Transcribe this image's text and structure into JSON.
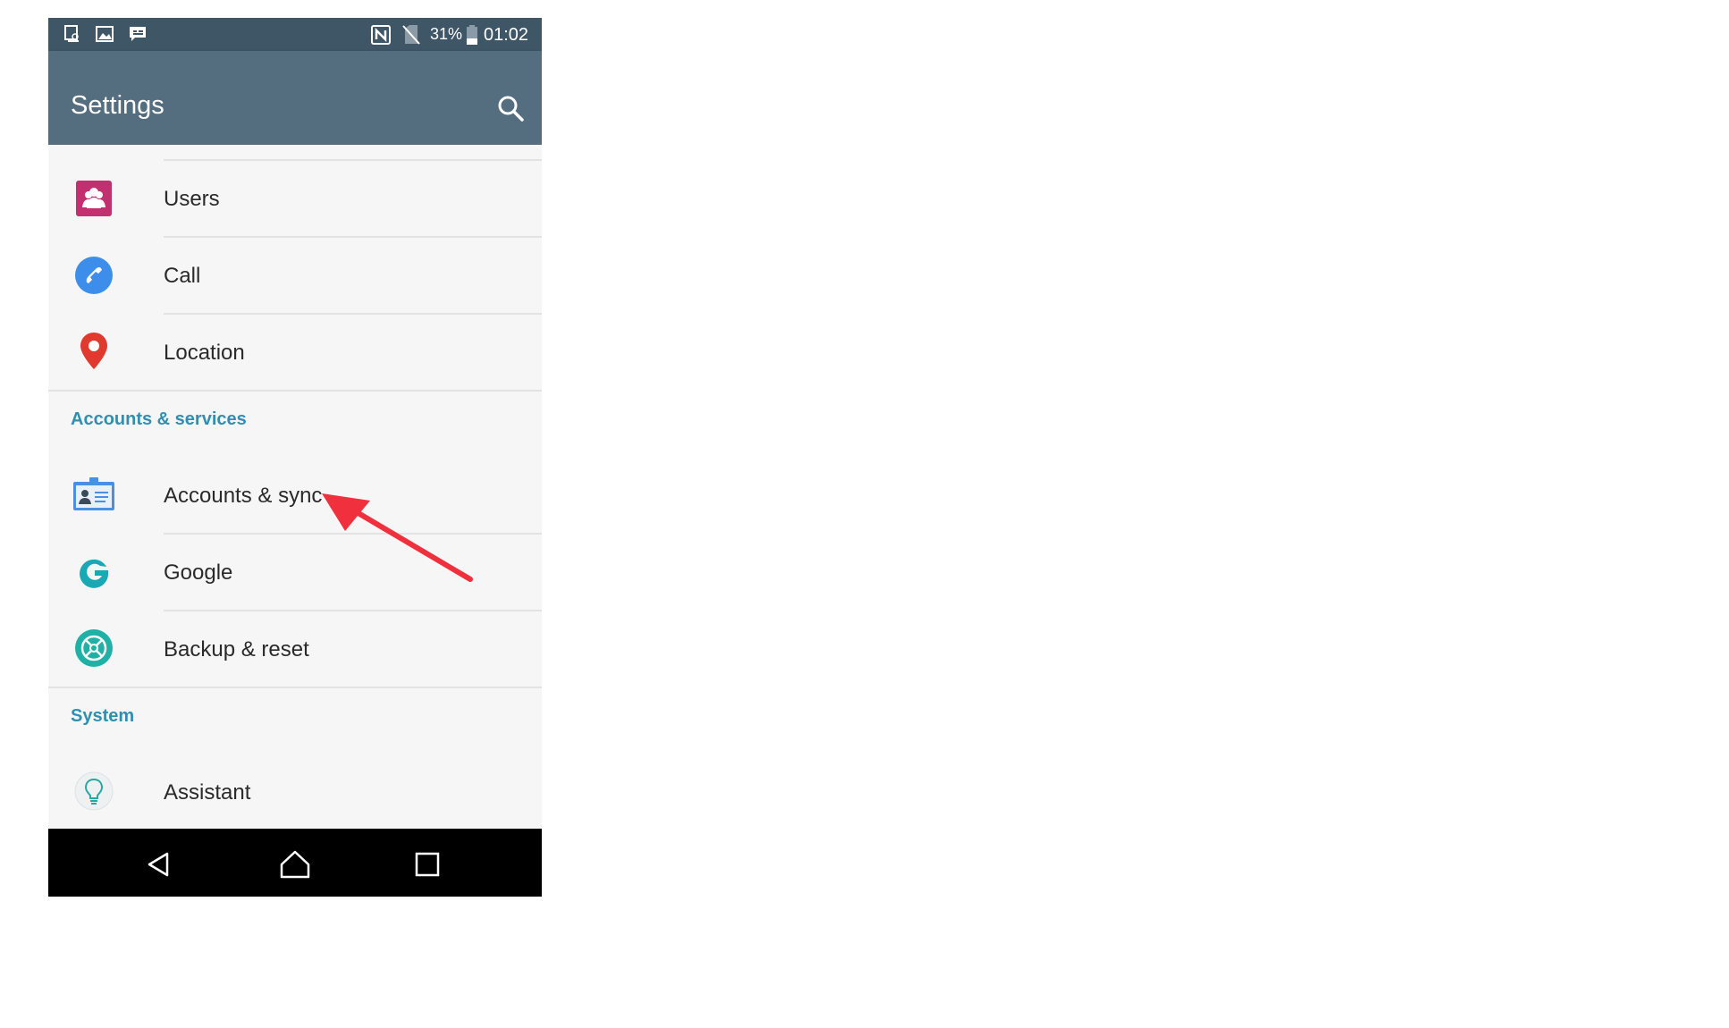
{
  "status_bar": {
    "battery": "31%",
    "time": "01:02"
  },
  "app_bar": {
    "title": "Settings",
    "search_icon": "search-icon"
  },
  "items_top": [
    {
      "label": "Users",
      "icon": "users-icon"
    },
    {
      "label": "Call",
      "icon": "call-icon"
    },
    {
      "label": "Location",
      "icon": "location-pin-icon"
    }
  ],
  "sections": {
    "accounts": {
      "title": "Accounts & services",
      "items": [
        {
          "label": "Accounts & sync",
          "icon": "accounts-sync-icon"
        },
        {
          "label": "Google",
          "icon": "google-icon"
        },
        {
          "label": "Backup & reset",
          "icon": "backup-reset-icon"
        }
      ]
    },
    "system": {
      "title": "System",
      "items": [
        {
          "label": "Assistant",
          "icon": "assistant-bulb-icon"
        }
      ]
    }
  },
  "nav_bar": {
    "back": "back-icon",
    "home": "home-icon",
    "recents": "recents-icon"
  },
  "colors": {
    "status_bar": "#3f5666",
    "app_bar": "#546e7f",
    "section_title": "#2f8fb3",
    "annotation_arrow": "#f0303c"
  }
}
